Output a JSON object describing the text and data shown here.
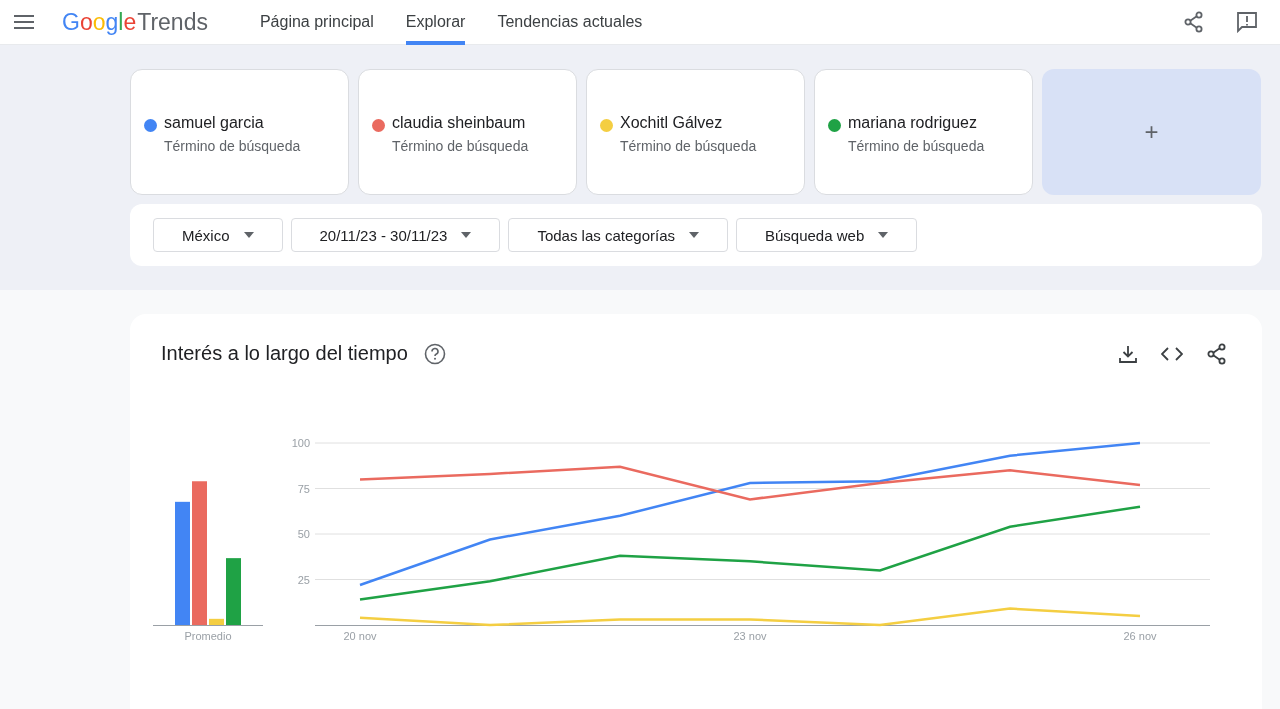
{
  "header": {
    "logo_google": "Google",
    "logo_trends": "Trends",
    "nav": [
      {
        "label": "Página principal",
        "selected": false
      },
      {
        "label": "Explorar",
        "selected": true
      },
      {
        "label": "Tendencias actuales",
        "selected": false
      }
    ]
  },
  "terms": [
    {
      "name": "samuel garcia",
      "type": "Término de búsqueda",
      "color": "#4285f4"
    },
    {
      "name": "claudia sheinbaum",
      "type": "Término de búsqueda",
      "color": "#ea6a5f"
    },
    {
      "name": "Xochitl Gálvez",
      "type": "Término de búsqueda",
      "color": "#f4ce42"
    },
    {
      "name": "mariana rodriguez",
      "type": "Término de búsqueda",
      "color": "#1fa245"
    }
  ],
  "add_button": "+",
  "filters": [
    "México",
    "20/11/23 - 30/11/23",
    "Todas las categorías",
    "Búsqueda web"
  ],
  "panel": {
    "title": "Interés a lo largo del tiempo",
    "average_label": "Promedio",
    "chart_data": {
      "type": "line",
      "categories": [
        "20 nov",
        null,
        null,
        "23 nov",
        null,
        null,
        "26 nov"
      ],
      "ylim": [
        0,
        100
      ],
      "grid": true,
      "yticks": [
        25,
        50,
        75,
        100
      ],
      "series": [
        {
          "color": "#4285f4",
          "values": [
            22,
            47,
            60,
            78,
            79,
            93,
            100
          ]
        },
        {
          "color": "#ea6a5f",
          "values": [
            80,
            83,
            87,
            69,
            78,
            85,
            77
          ]
        },
        {
          "color": "#f4ce42",
          "values": [
            4,
            0,
            3,
            3,
            0,
            9,
            5
          ]
        },
        {
          "color": "#1fa245",
          "values": [
            14,
            24,
            38,
            35,
            30,
            54,
            65
          ]
        }
      ]
    }
  }
}
